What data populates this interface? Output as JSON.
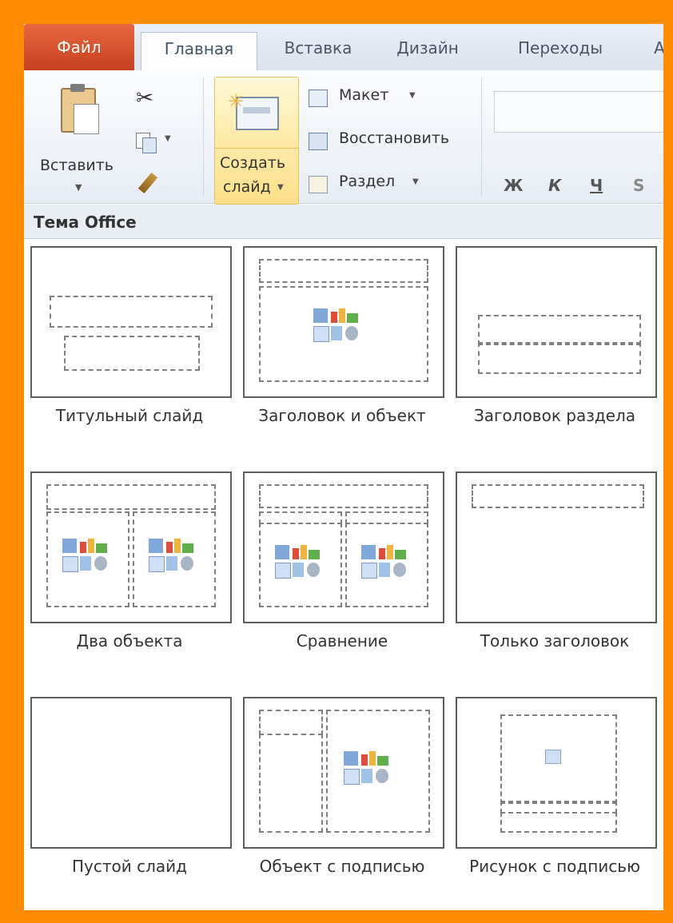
{
  "tabs": [
    {
      "label": "Файл"
    },
    {
      "label": "Главная"
    },
    {
      "label": "Вставка"
    },
    {
      "label": "Дизайн"
    },
    {
      "label": "Переходы"
    }
  ],
  "ribbon": {
    "paste_label": "Вставить",
    "new_slide_label_1": "Создать",
    "new_slide_label_2": "слайд",
    "layout_label": "Макет",
    "reset_label": "Восстановить",
    "section_label": "Раздел",
    "format_bold": "Ж",
    "format_italic": "К",
    "format_underline": "Ч",
    "format_strike": "S"
  },
  "gallery": {
    "title": "Тема Office",
    "layouts": [
      {
        "name": "Титульный слайд"
      },
      {
        "name": "Заголовок и объект"
      },
      {
        "name": "Заголовок раздела"
      },
      {
        "name": "Два объекта"
      },
      {
        "name": "Сравнение"
      },
      {
        "name": "Только заголовок"
      },
      {
        "name": "Пустой слайд"
      },
      {
        "name": "Объект с подписью"
      },
      {
        "name": "Рисунок с подписью"
      }
    ]
  }
}
